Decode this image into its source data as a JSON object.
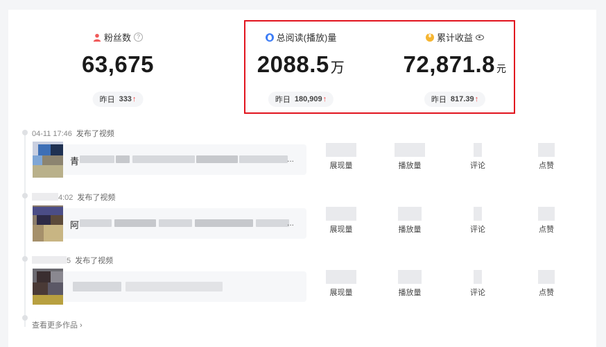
{
  "stats": [
    {
      "title": "粉丝数",
      "value": "63,675",
      "unit": "",
      "pill_label": "昨日",
      "pill_value": "333",
      "arrow": "↑",
      "icon": "person-icon"
    },
    {
      "title": "总阅读(播放)量",
      "value": "2088.5",
      "unit": "万",
      "pill_label": "昨日",
      "pill_value": "180,909",
      "arrow": "↑",
      "icon": "drop-icon"
    },
    {
      "title": "累计收益",
      "value": "72,871.8",
      "unit": "元",
      "pill_label": "昨日",
      "pill_value": "817.39",
      "arrow": "↑",
      "icon": "coin-icon"
    }
  ],
  "help_glyph": "?",
  "entries": [
    {
      "time": "04-11 17:46",
      "action": "发布了视频",
      "title_char": "青",
      "ellipsis": "..."
    },
    {
      "time": "4:02",
      "action": "发布了视频",
      "title_char": "阿",
      "ellipsis": "..."
    },
    {
      "time": "5",
      "action": "发布了视频",
      "title_char": "",
      "ellipsis": ""
    }
  ],
  "metric_labels": [
    "展现量",
    "播放量",
    "评论",
    "点赞"
  ],
  "more_link": "查看更多作品 ›",
  "colors": {
    "accent_red": "#f04142",
    "highlight_border": "#e1141e",
    "blue_icon": "#3c7cf6",
    "gold_icon": "#f6b531"
  }
}
